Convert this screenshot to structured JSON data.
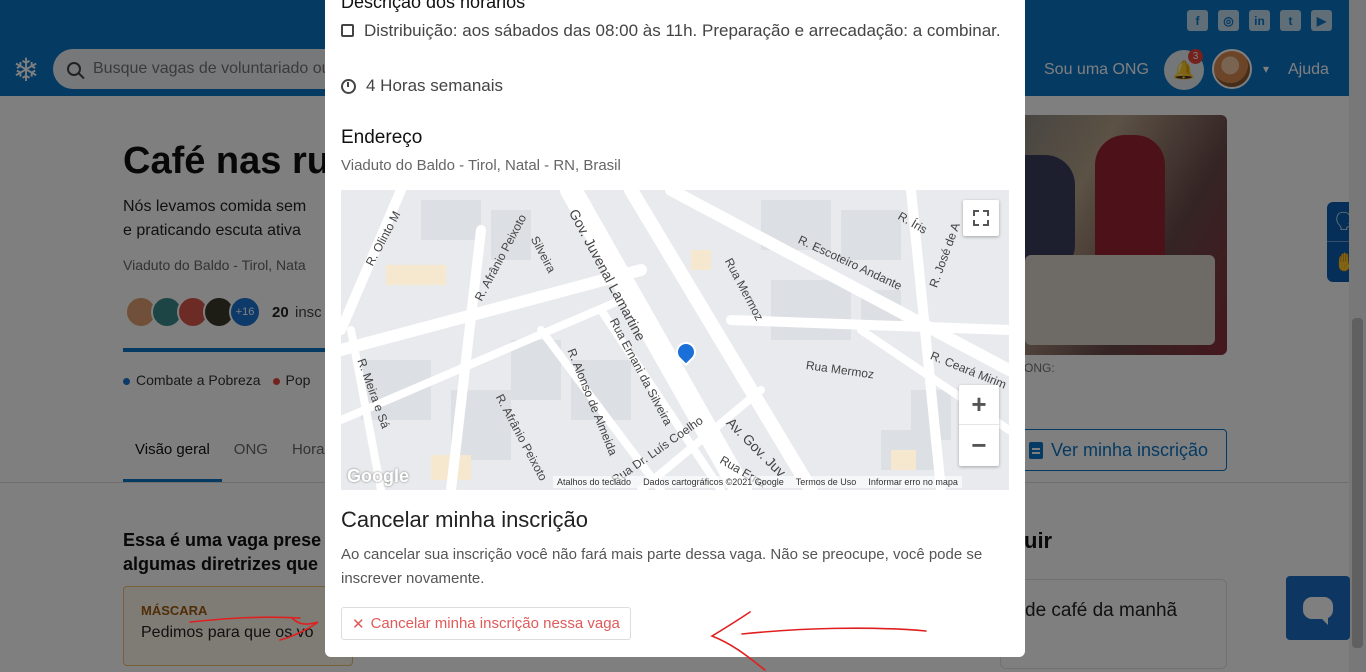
{
  "header": {
    "search_placeholder": "Busque vagas de voluntariado ou ONGs",
    "sou_uma_ong": "Sou uma ONG",
    "notification_count": "3",
    "help": "Ajuda",
    "social_icons": [
      "facebook-icon",
      "instagram-icon",
      "linkedin-icon",
      "twitter-icon",
      "youtube-icon"
    ]
  },
  "page": {
    "title": "Café nas ru",
    "description_line1": "Nós levamos comida sem",
    "description_line2": "e praticando escuta ativa",
    "location": "Viaduto do Baldo - Tirol, Nata",
    "avatars_more": "+16",
    "inscritos_count": "20",
    "inscritos_text": "insc",
    "causes": [
      {
        "label": "Combate a Pobreza",
        "color": "#1a74d2"
      },
      {
        "label": "Pop",
        "color": "#e8453c"
      }
    ],
    "tabs": [
      "Visão geral",
      "ONG",
      "Hora"
    ],
    "section_line1": "Essa é uma vaga prese",
    "section_line2": "algumas diretrizes que",
    "mask_title": "MÁSCARA",
    "mask_text": "Pedimos para que os vo",
    "ong_label": "ONG:",
    "ver_inscricao": "Ver minha inscrição",
    "right_heading": "uir",
    "right_card": "de café da manhã"
  },
  "modal": {
    "schedule_title": "Descrição dos horários",
    "schedule_text": "Distribuição: aos sábados das 08:00 às 11h. Preparação e arrecadação: a combinar.",
    "hours": "4 Horas semanais",
    "address_title": "Endereço",
    "address": "Viaduto do Baldo - Tirol, Natal - RN, Brasil",
    "map": {
      "street_labels": [
        "R. Olinto M",
        "R. Afrânio Peixoto",
        "Silveira",
        "Gov. Juvenal Lamartine",
        "R. Íris",
        "R. José de A",
        "R. Escoteiro Andante",
        "Rua Mermoz",
        "Rua Mermoz",
        "R. Ceará Mirim",
        "R. Meira e Sá",
        "R. Afrânio Peixoto",
        "R. Alonso de Almeida",
        "Rua Ernani da Silveira",
        "Rua Dr. Luís Coelho",
        "Av. Gov. Juv",
        "Rua Erna"
      ],
      "google": "Google",
      "attribution": [
        "Atalhos do teclado",
        "Dados cartográficos ©2021 Google",
        "Termos de Uso",
        "Informar erro no mapa"
      ]
    },
    "cancel_title": "Cancelar minha inscrição",
    "cancel_desc": "Ao cancelar sua inscrição você não fará mais parte dessa vaga. Não se preocupe, você pode se inscrever novamente.",
    "cancel_button": "Cancelar minha inscrição nessa vaga"
  },
  "colors": {
    "brand_blue": "#0a74c7",
    "danger": "#e05a5a",
    "annotation_red": "#e02020"
  }
}
